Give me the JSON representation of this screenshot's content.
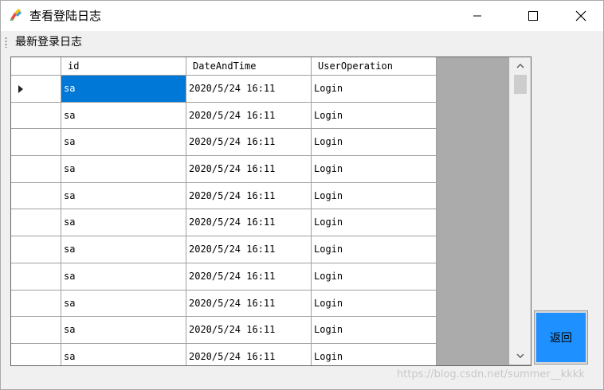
{
  "window": {
    "title": "查看登陆日志",
    "controls": {
      "minimize": "minimize",
      "maximize": "maximize",
      "close": "close"
    }
  },
  "toolbar": {
    "menu_label": "最新登录日志"
  },
  "grid": {
    "columns": [
      "id",
      "DateAndTime",
      "UserOperation"
    ],
    "rows": [
      [
        "sa",
        "2020/5/24 16:11",
        "Login"
      ],
      [
        "sa",
        "2020/5/24 16:11",
        "Login"
      ],
      [
        "sa",
        "2020/5/24 16:11",
        "Login"
      ],
      [
        "sa",
        "2020/5/24 16:11",
        "Login"
      ],
      [
        "sa",
        "2020/5/24 16:11",
        "Login"
      ],
      [
        "sa",
        "2020/5/24 16:11",
        "Login"
      ],
      [
        "sa",
        "2020/5/24 16:11",
        "Login"
      ],
      [
        "sa",
        "2020/5/24 16:11",
        "Login"
      ],
      [
        "sa",
        "2020/5/24 16:11",
        "Login"
      ],
      [
        "sa",
        "2020/5/24 16:11",
        "Login"
      ],
      [
        "sa",
        "2020/5/24 16:11",
        "Login"
      ]
    ],
    "selected_row": 0,
    "selected_col": 0
  },
  "return_button": {
    "label": "返回"
  },
  "watermark": "https://blog.csdn.net/summer__kkkk",
  "colors": {
    "selection": "#0078d7",
    "return_button": "#1e90ff",
    "grid_background": "#ababab"
  }
}
